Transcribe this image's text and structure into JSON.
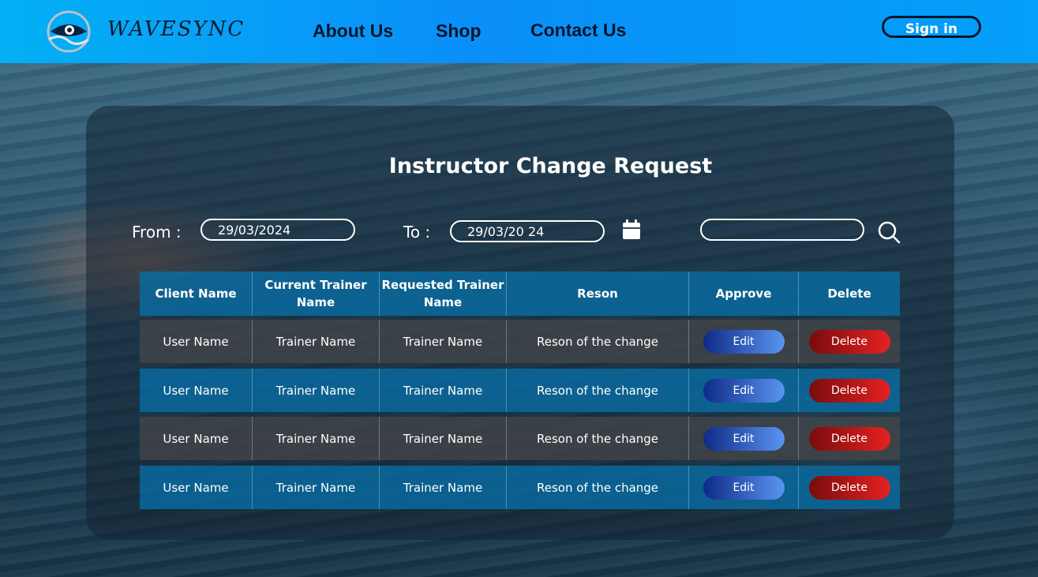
{
  "header": {
    "brand": "WAVESYNC",
    "nav": [
      "About Us",
      "Shop",
      "Contact Us"
    ],
    "signin_label": "Sign in"
  },
  "page": {
    "title": "Instructor Change Request"
  },
  "filters": {
    "from_label": "From :",
    "from_value": "29/03/2024",
    "to_label": "To :",
    "to_value": "29/03/20 24",
    "search_value": ""
  },
  "table": {
    "columns": [
      "Client Name",
      "Current Trainer Name",
      "Requested Trainer Name",
      "Reson",
      "Approve",
      "Delete"
    ],
    "rows": [
      {
        "client": "User Name",
        "current": "Trainer Name",
        "requested": "Trainer Name",
        "reason": "Reson of the change",
        "approve": "Edit",
        "delete": "Delete"
      },
      {
        "client": "User Name",
        "current": "Trainer Name",
        "requested": "Trainer Name",
        "reason": "Reson of the change",
        "approve": "Edit",
        "delete": "Delete"
      },
      {
        "client": "User Name",
        "current": "Trainer Name",
        "requested": "Trainer Name",
        "reason": "Reson of the change",
        "approve": "Edit",
        "delete": "Delete"
      },
      {
        "client": "User Name",
        "current": "Trainer Name",
        "requested": "Trainer Name",
        "reason": "Reson of the change",
        "approve": "Edit",
        "delete": "Delete"
      }
    ]
  },
  "colors": {
    "header_blue": "#0a8ff8",
    "row_blue": "#086ea5",
    "row_grey": "#464648",
    "edit_button": "#3a6fd8",
    "delete_button": "#e52222"
  },
  "icons": [
    "wave-eye-logo",
    "calendar-icon",
    "search-icon"
  ]
}
